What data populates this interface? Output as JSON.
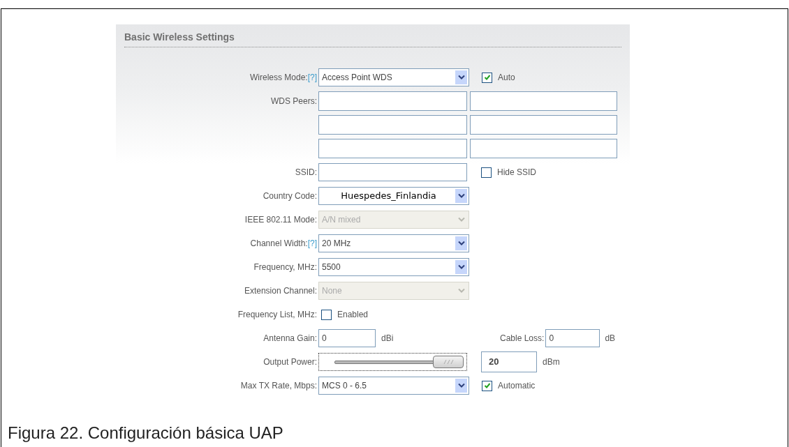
{
  "section_title": "Basic Wireless Settings",
  "rows": [
    {
      "kind": "select",
      "label": "Wireless Mode:",
      "help": "[?]",
      "value": "Access Point WDS",
      "disabled": false,
      "checkbox": {
        "label": "Auto",
        "checked": true
      }
    },
    {
      "kind": "field_pair",
      "label": "WDS Peers:"
    },
    {
      "kind": "field_pair"
    },
    {
      "kind": "field_pair"
    },
    {
      "kind": "text",
      "label": "SSID:",
      "checkbox": {
        "label": "Hide SSID",
        "checked": false
      }
    },
    {
      "kind": "select",
      "label": "Country Code:",
      "value": "Huespedes_Finlandia",
      "overlay": true,
      "disabled": false
    },
    {
      "kind": "select",
      "label": "IEEE 802.11 Mode:",
      "value": "A/N mixed",
      "disabled": true
    },
    {
      "kind": "select",
      "label": "Channel Width:",
      "help": "[?]",
      "value": "20 MHz",
      "disabled": false
    },
    {
      "kind": "select",
      "label": "Frequency, MHz:",
      "value": "5500",
      "disabled": false
    },
    {
      "kind": "select",
      "label": "Extension Channel:",
      "value": "None",
      "disabled": true
    },
    {
      "kind": "checkbox",
      "label": "Frequency List, MHz:",
      "checkbox": {
        "label": "Enabled",
        "checked": false
      }
    },
    {
      "kind": "gain",
      "label": "Antenna Gain:",
      "value": "0",
      "unit": "dBi",
      "label2": "Cable Loss:",
      "value2": "0",
      "unit2": "dB"
    },
    {
      "kind": "slider",
      "label": "Output Power:",
      "level": 1,
      "value": "20",
      "unit": "dBm"
    },
    {
      "kind": "select",
      "label": "Max TX Rate, Mbps:",
      "value": "MCS 0 - 6.5",
      "disabled": false,
      "checkbox": {
        "label": "Automatic",
        "checked": true
      }
    }
  ],
  "caption": "Figura 22. Configuración básica UAP"
}
